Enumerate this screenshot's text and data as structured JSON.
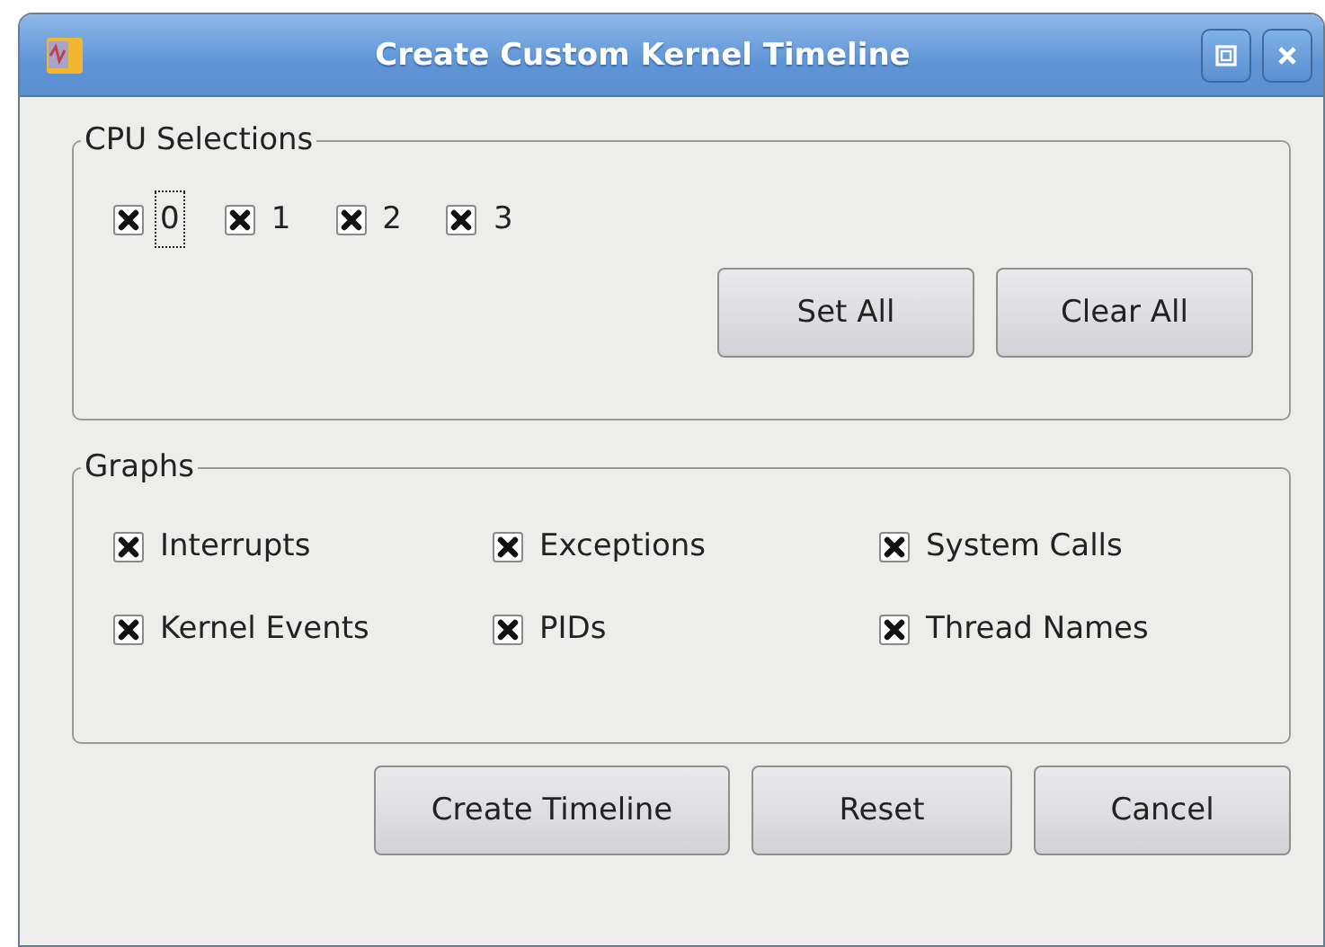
{
  "window": {
    "title": "Create Custom Kernel Timeline",
    "controls": [
      {
        "kind": "maximize"
      },
      {
        "kind": "close"
      }
    ]
  },
  "cpu_selections": {
    "title": "CPU Selections",
    "cpus": [
      {
        "label": "0",
        "checked": true,
        "focused": true
      },
      {
        "label": "1",
        "checked": true,
        "focused": false
      },
      {
        "label": "2",
        "checked": true,
        "focused": false
      },
      {
        "label": "3",
        "checked": true,
        "focused": false
      }
    ],
    "buttons": [
      "Set All",
      "Clear All"
    ]
  },
  "graphs": {
    "title": "Graphs",
    "items": [
      {
        "label": "Interrupts",
        "checked": true
      },
      {
        "label": "Exceptions",
        "checked": true
      },
      {
        "label": "System Calls",
        "checked": true
      },
      {
        "label": "Kernel Events",
        "checked": true
      },
      {
        "label": "PIDs",
        "checked": true
      },
      {
        "label": "Thread Names",
        "checked": true
      }
    ]
  },
  "buttons": [
    "Create Timeline",
    "Reset",
    "Cancel"
  ]
}
